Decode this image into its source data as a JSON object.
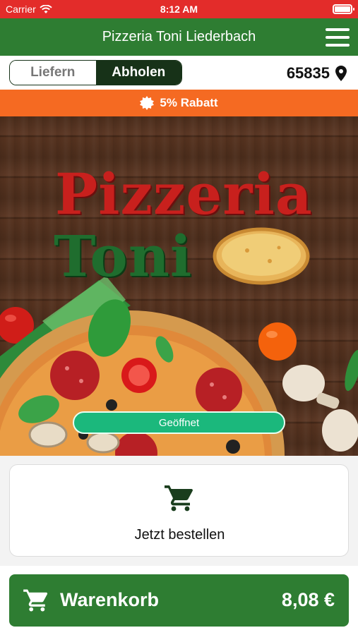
{
  "status": {
    "carrier": "Carrier",
    "time": "8:12 AM"
  },
  "header": {
    "title": "Pizzeria Toni Liederbach"
  },
  "mode": {
    "delivery_label": "Liefern",
    "pickup_label": "Abholen",
    "selected": "Abholen",
    "zip": "65835"
  },
  "discount": {
    "label": "5% Rabatt"
  },
  "hero": {
    "logo_line1": "Pizzeria",
    "logo_line2": "Toni",
    "open_status": "Geöffnet"
  },
  "order": {
    "label": "Jetzt bestellen"
  },
  "basket": {
    "label": "Warenkorb",
    "price": "8,08 €"
  },
  "colors": {
    "status_bar": "#e32c2a",
    "nav_green": "#2e7d32",
    "segment_dark": "#173218",
    "discount_orange": "#f56a22",
    "open_green": "#1bb87c"
  }
}
